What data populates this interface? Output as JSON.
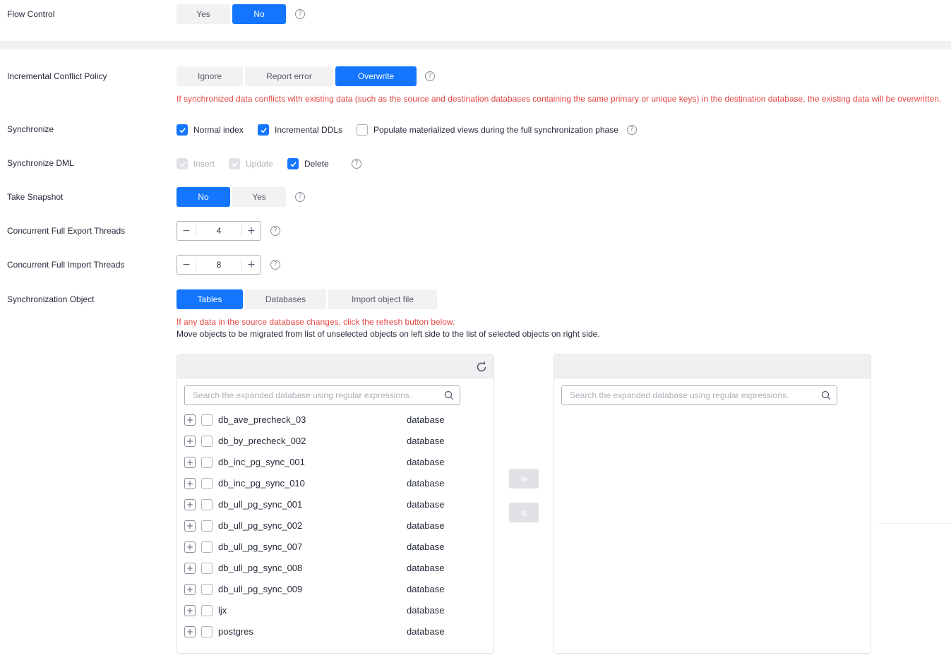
{
  "flow_control": {
    "label": "Flow Control",
    "options": [
      "Yes",
      "No"
    ],
    "selected": "No"
  },
  "conflict_policy": {
    "label": "Incremental Conflict Policy",
    "options": [
      "Ignore",
      "Report error",
      "Overwrite"
    ],
    "selected": "Overwrite",
    "note": "If synchronized data conflicts with existing data (such as the source and destination databases containing the same primary or unique keys) in the destination database, the existing data will be overwritten."
  },
  "synchronize": {
    "label": "Synchronize",
    "items": [
      {
        "label": "Normal index",
        "checked": true
      },
      {
        "label": "Incremental DDLs",
        "checked": true
      },
      {
        "label": "Populate materialized views during the full synchronization phase",
        "checked": false
      }
    ]
  },
  "synchronize_dml": {
    "label": "Synchronize DML",
    "items": [
      {
        "label": "Insert",
        "checked": true,
        "disabled": true
      },
      {
        "label": "Update",
        "checked": true,
        "disabled": true
      },
      {
        "label": "Delete",
        "checked": true,
        "disabled": false
      }
    ]
  },
  "take_snapshot": {
    "label": "Take Snapshot",
    "options": [
      "No",
      "Yes"
    ],
    "selected": "No"
  },
  "export_threads": {
    "label": "Concurrent Full Export Threads",
    "value": "4",
    "minus": "−",
    "plus": "+"
  },
  "import_threads": {
    "label": "Concurrent Full Import Threads",
    "value": "8",
    "minus": "−",
    "plus": "+"
  },
  "sync_object": {
    "label": "Synchronization Object",
    "options": [
      "Tables",
      "Databases",
      "Import object file"
    ],
    "selected": "Tables",
    "note_red": "If any data in the source database changes, click the refresh button below.",
    "note": "Move objects to be migrated from list of unselected objects on left side to the list of selected objects on right side."
  },
  "left_panel": {
    "search_placeholder": "Search the expanded database using regular expressions.",
    "items": [
      {
        "name": "db_ave_precheck_03",
        "type": "database"
      },
      {
        "name": "db_by_precheck_002",
        "type": "database"
      },
      {
        "name": "db_inc_pg_sync_001",
        "type": "database"
      },
      {
        "name": "db_inc_pg_sync_010",
        "type": "database"
      },
      {
        "name": "db_ull_pg_sync_001",
        "type": "database"
      },
      {
        "name": "db_ull_pg_sync_002",
        "type": "database"
      },
      {
        "name": "db_ull_pg_sync_007",
        "type": "database"
      },
      {
        "name": "db_ull_pg_sync_008",
        "type": "database"
      },
      {
        "name": "db_ull_pg_sync_009",
        "type": "database"
      },
      {
        "name": "ljx",
        "type": "database"
      },
      {
        "name": "postgres",
        "type": "database"
      }
    ]
  },
  "right_panel": {
    "search_placeholder": "Search the expanded database using regular expressions."
  },
  "icons": {
    "help": "?",
    "expand": "+",
    "move_right": "»",
    "move_left": "«"
  },
  "colors": {
    "primary": "#1476ff",
    "error_text": "#e54545",
    "segment_inactive": "#f2f2f2",
    "panel_header": "#f0f0f3"
  }
}
